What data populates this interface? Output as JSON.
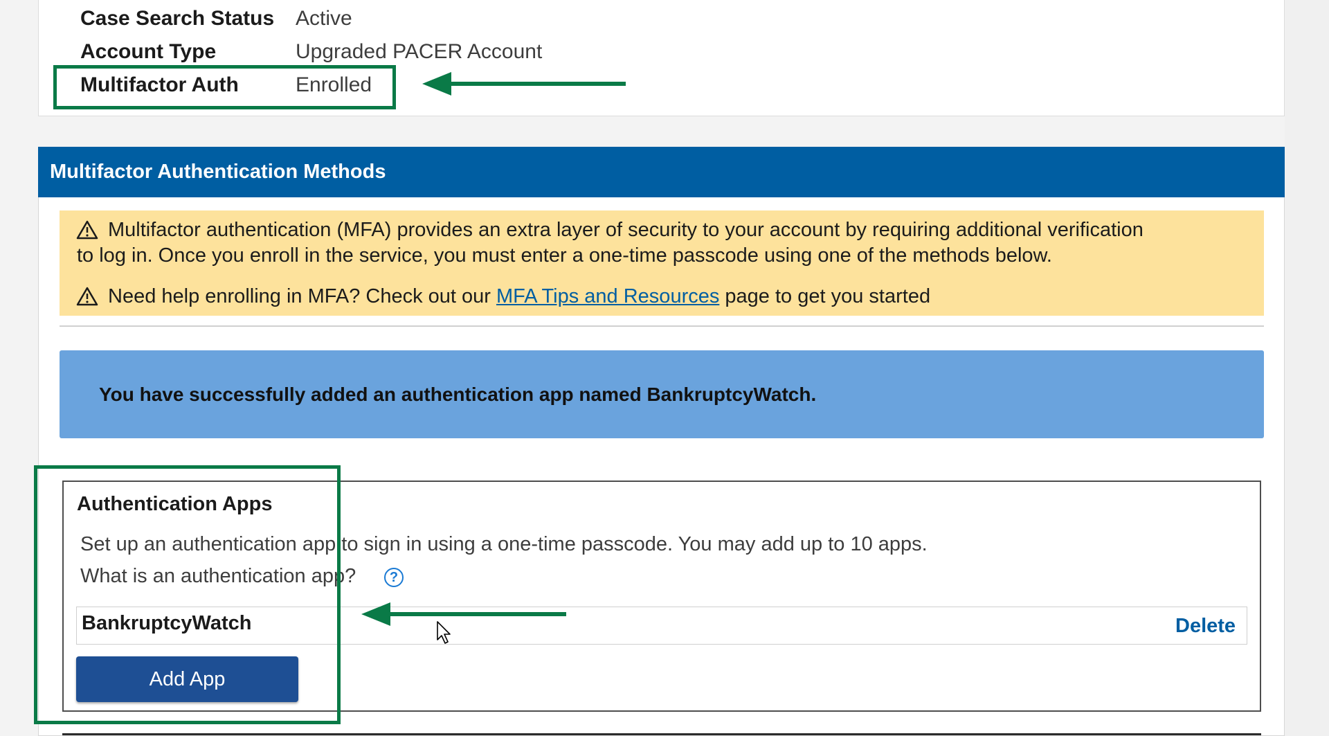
{
  "account": {
    "rows": [
      {
        "label": "Case Search Status",
        "value": "Active"
      },
      {
        "label": "Account Type",
        "value": "Upgraded PACER Account"
      },
      {
        "label": "Multifactor Auth",
        "value": "Enrolled"
      }
    ]
  },
  "mfa": {
    "header": "Multifactor Authentication Methods",
    "warning_line1": "Multifactor authentication (MFA) provides an extra layer of security to your account by requiring additional verification",
    "warning_line2": "to log in. Once you enroll in the service, you must enter a one-time passcode using one of the methods below.",
    "help_prefix": "Need help enrolling in MFA? Check out our ",
    "help_link": "MFA Tips and Resources",
    "help_suffix": " page to get you started",
    "success_message": "You have successfully added an authentication app named BankruptcyWatch."
  },
  "apps": {
    "title": "Authentication Apps",
    "description": "Set up an authentication app to sign in using a one-time passcode. You may add up to 10 apps.",
    "question": "What is an authentication app?",
    "help_glyph": "?",
    "items": [
      {
        "name": "BankruptcyWatch",
        "action": "Delete"
      }
    ],
    "add_button": "Add App"
  },
  "icons": {
    "warning": "warning-triangle-icon",
    "help": "question-circle-icon",
    "cursor": "mouse-pointer-icon",
    "annotation_arrow": "arrow-left-icon"
  },
  "colors": {
    "header_blue": "#005ea2",
    "warning_bg": "#fde29c",
    "success_bg": "#6aa3dd",
    "annotation_green": "#0a7a47",
    "button_blue": "#1e4f94"
  }
}
